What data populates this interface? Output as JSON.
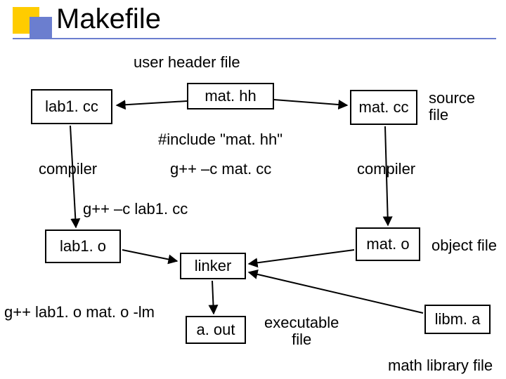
{
  "title": "Makefile",
  "labels": {
    "user_header_file": "user header file",
    "source_file": "source file",
    "compiler_left": "compiler",
    "compiler_right": "compiler",
    "gpp_mat": "g++ –c mat. cc",
    "gpp_lab1": "g++ –c lab1. cc",
    "object_file": "object file",
    "linker_cmd": "g++ lab1. o mat. o -lm",
    "exec_file": "executable file",
    "math_lib": "math library file",
    "include": "#include \"mat. hh\""
  },
  "boxes": {
    "lab1_cc": "lab1. cc",
    "mat_hh": "mat. hh",
    "mat_cc": "mat. cc",
    "lab1_o": "lab1. o",
    "mat_o": "mat. o",
    "linker": "linker",
    "aout": "a. out",
    "libm": "libm. a"
  },
  "chart_data": {
    "type": "table",
    "title": "Makefile build dependency diagram",
    "nodes": [
      {
        "id": "lab1.cc",
        "kind": "source"
      },
      {
        "id": "mat.hh",
        "kind": "header",
        "note": "#include \"mat.hh\""
      },
      {
        "id": "mat.cc",
        "kind": "source"
      },
      {
        "id": "lab1.o",
        "kind": "object"
      },
      {
        "id": "mat.o",
        "kind": "object"
      },
      {
        "id": "linker",
        "kind": "tool"
      },
      {
        "id": "a.out",
        "kind": "executable"
      },
      {
        "id": "libm.a",
        "kind": "library"
      }
    ],
    "edges": [
      {
        "from": "mat.hh",
        "to": "lab1.cc",
        "label": "user header file"
      },
      {
        "from": "mat.hh",
        "to": "mat.cc",
        "label": "source file"
      },
      {
        "from": "lab1.cc",
        "to": "lab1.o",
        "label": "compiler g++ -c lab1.cc"
      },
      {
        "from": "mat.cc",
        "to": "mat.o",
        "label": "compiler g++ -c mat.cc"
      },
      {
        "from": "lab1.o",
        "to": "linker"
      },
      {
        "from": "mat.o",
        "to": "linker"
      },
      {
        "from": "libm.a",
        "to": "linker"
      },
      {
        "from": "linker",
        "to": "a.out",
        "label": "g++ lab1.o mat.o -lm, executable file"
      }
    ]
  }
}
